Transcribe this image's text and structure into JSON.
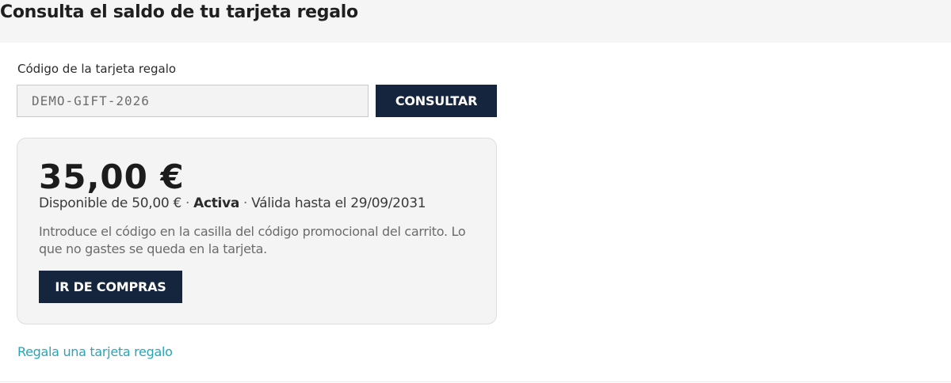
{
  "page": {
    "title": "Consulta el saldo de tu tarjeta regalo"
  },
  "form": {
    "label": "Código de la tarjeta regalo",
    "code_value": "DEMO-GIFT-2026",
    "submit_label": "CONSULTAR"
  },
  "result": {
    "balance": "35,00 €",
    "available_text": "Disponible de 50,00 €",
    "separator": "·",
    "status": "Activa",
    "valid_until": "Válida hasta el 29/09/2031",
    "instructions": "Introduce el código en la casilla del código promocional del carrito. Lo que no gastes se queda en la tarjeta.",
    "shop_button_label": "IR DE COMPRAS"
  },
  "footer": {
    "gift_link_label": "Regala una tarjeta regalo"
  },
  "colors": {
    "primary_dark": "#14253d",
    "link": "#27a6b8",
    "header_bg": "#f5f5f5",
    "card_bg": "#f3f4f3"
  }
}
